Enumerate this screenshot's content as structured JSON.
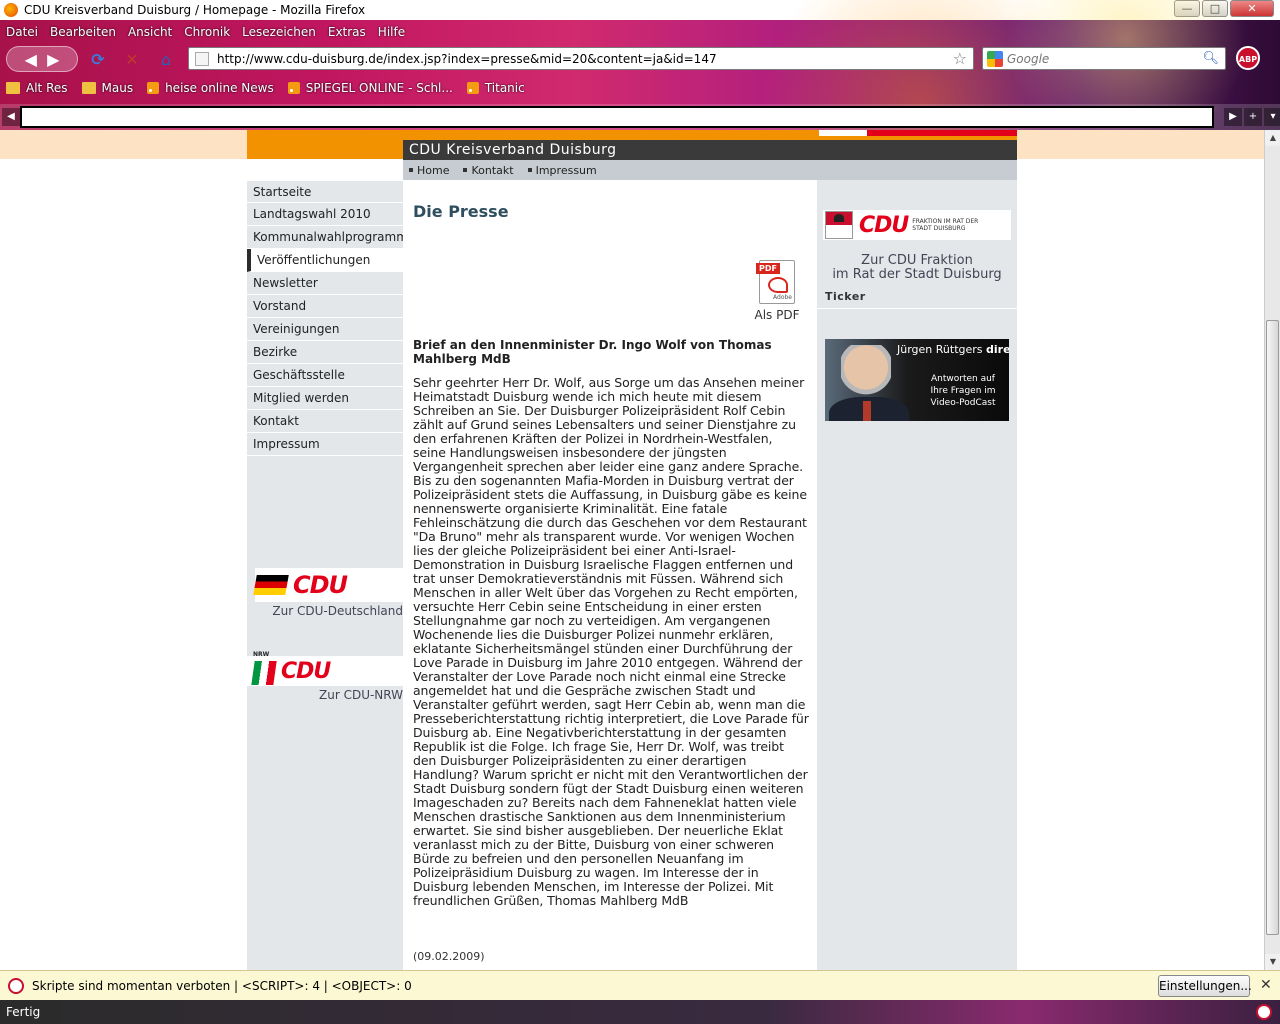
{
  "window": {
    "title": "CDU Kreisverband Duisburg / Homepage - Mozilla Firefox",
    "controls": {
      "minimize": "—",
      "maximize": "□",
      "close": "✕"
    }
  },
  "menu": [
    "Datei",
    "Bearbeiten",
    "Ansicht",
    "Chronik",
    "Lesezeichen",
    "Extras",
    "Hilfe"
  ],
  "nav": {
    "url": "http://www.cdu-duisburg.de/index.jsp?index=presse&mid=20&content=ja&id=147",
    "search_placeholder": "Google",
    "abp_label": "ABP"
  },
  "bookmarks": [
    {
      "label": "Alt Res",
      "kind": "folder"
    },
    {
      "label": "Maus",
      "kind": "folder"
    },
    {
      "label": "heise online News",
      "kind": "rss"
    },
    {
      "label": "SPIEGEL ONLINE - Schl...",
      "kind": "rss"
    },
    {
      "label": "Titanic",
      "kind": "rss"
    }
  ],
  "site": {
    "header": "CDU Kreisverband Duisburg",
    "topnav": [
      "Home",
      "Kontakt",
      "Impressum"
    ],
    "leftnav": [
      {
        "label": "Startseite",
        "active": false
      },
      {
        "label": "Landtagswahl 2010",
        "active": false
      },
      {
        "label": "Kommunalwahlprogramm",
        "active": false
      },
      {
        "label": "Veröffentlichungen",
        "active": true
      },
      {
        "label": "Newsletter",
        "active": false
      },
      {
        "label": "Vorstand",
        "active": false
      },
      {
        "label": "Vereinigungen",
        "active": false
      },
      {
        "label": "Bezirke",
        "active": false
      },
      {
        "label": "Geschäftsstelle",
        "active": false
      },
      {
        "label": "Mitglied werden",
        "active": false
      },
      {
        "label": "Kontakt",
        "active": false
      },
      {
        "label": "Impressum",
        "active": false
      }
    ],
    "cdu_de": {
      "logo": "CDU",
      "caption": "Zur CDU-Deutschland"
    },
    "cdu_nrw": {
      "logo": "CDU",
      "badge": "NRW",
      "caption": "Zur CDU-NRW"
    },
    "main": {
      "heading": "Die Presse",
      "pdf_badge": "PDF",
      "pdf_brand": "Adobe",
      "pdf_label": "Als PDF",
      "article_title": "Brief an den Innenminister Dr. Ingo Wolf von Thomas Mahlberg MdB",
      "article_body": "Sehr geehrter Herr Dr. Wolf, aus Sorge um das Ansehen meiner Heimatstadt Duisburg wende ich mich heute mit diesem Schreiben an Sie. Der Duisburger Polizeipräsident Rolf Cebin zählt auf Grund seines Lebensalters und seiner Dienstjahre zu den erfahrenen Kräften der Polizei in Nordrhein-Westfalen, seine Handlungsweisen insbesondere der jüngsten Vergangenheit sprechen aber leider eine ganz andere Sprache. Bis zu den sogenannten Mafia-Morden in Duisburg vertrat der Polizeipräsident stets die Auffassung, in Duisburg gäbe es keine nennenswerte organisierte Kriminalität. Eine fatale Fehleinschätzung die durch das Geschehen vor dem Restaurant \"Da Bruno\" mehr als transparent wurde. Vor wenigen Wochen lies der gleiche Polizeipräsident bei einer Anti-Israel-Demonstration in Duisburg Israelische Flaggen entfernen und trat unser Demokratieverständnis mit Füssen. Während sich Menschen in aller Welt über das Vorgehen zu Recht empörten, versuchte Herr Cebin seine Entscheidung in einer ersten Stellungnahme gar noch zu verteidigen. Am vergangenen Wochenende lies die Duisburger Polizei nunmehr erklären, eklatante Sicherheitsmängel stünden einer Durchführung der Love Parade in Duisburg im Jahre 2010 entgegen. Während der Veranstalter der Love Parade noch nicht einmal eine Strecke angemeldet hat und die Gespräche zwischen Stadt und Veranstalter geführt werden, sagt Herr Cebin ab, wenn man die Presseberichterstattung richtig interpretiert, die Love Parade für Duisburg ab. Eine Negativberichterstattung in der gesamten Republik ist die Folge. Ich frage Sie, Herr Dr. Wolf, was treibt den Duisburger Polizeipräsidenten zu einer derartigen Handlung? Warum spricht er nicht mit den Verantwortlichen der Stadt Duisburg sondern fügt der Stadt Duisburg einen weiteren Imageschaden zu? Bereits nach dem Fahneneklat hatten viele Menschen drastische Sanktionen aus dem Innenministerium erwartet. Sie sind bisher ausgeblieben. Der neuerliche Eklat veranlasst mich zu der Bitte, Duisburg von einer schweren Bürde zu befreien und den personellen Neuanfang im Polizeipräsidium Duisburg zu wagen. Im Interesse der in Duisburg lebenden Menschen, im Interesse der Polizei. Mit freundlichen Grüßen, Thomas Mahlberg MdB",
      "date": "(09.02.2009)"
    },
    "right": {
      "fraktion_logo": "CDU",
      "fraktion_logo_sub": "FRAKTION IM RAT DER STADT DUISBURG",
      "fraktion_caption_line1": "Zur CDU Fraktion",
      "fraktion_caption_line2": "im Rat der Stadt Duisburg",
      "ticker": "Ticker",
      "banner_headline": "Jürgen Rüttgers",
      "banner_headline_bold": "direkt",
      "banner_sub": "Antworten auf Ihre Fragen im Video-PodCast"
    }
  },
  "notification": {
    "message": "Skripte sind momentan verboten | <SCRIPT>: 4 | <OBJECT>: 0",
    "button": "Einstellungen...",
    "close": "✕"
  },
  "status": "Fertig"
}
